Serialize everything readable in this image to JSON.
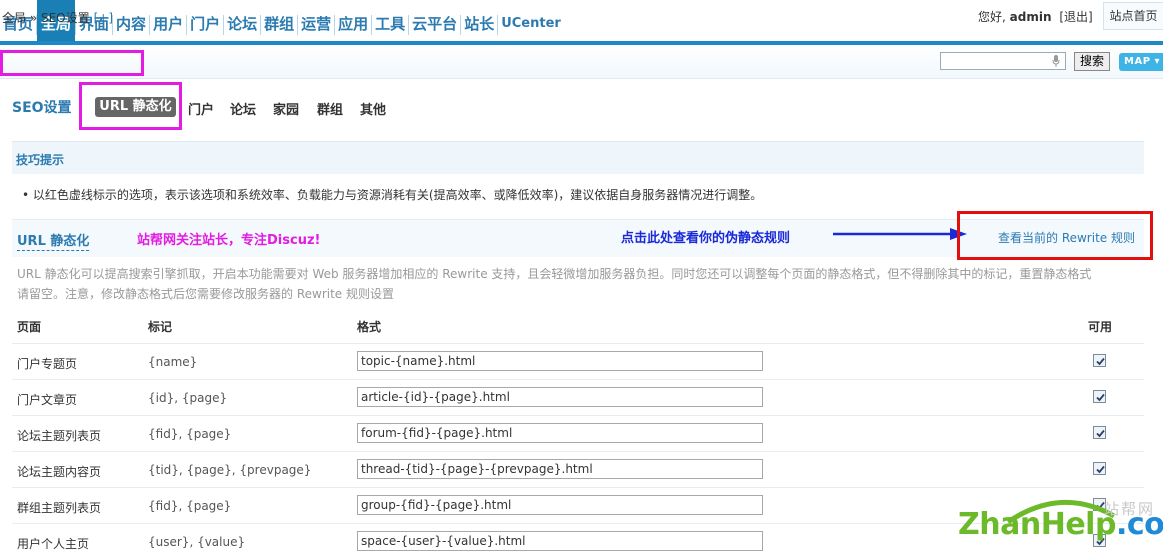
{
  "nav": {
    "tabs": [
      "首页",
      "全局",
      "界面",
      "内容",
      "用户",
      "门户",
      "论坛",
      "群组",
      "运营",
      "应用",
      "工具",
      "云平台",
      "站长",
      "UCenter"
    ],
    "active_index": 1,
    "greeting": "您好,",
    "username": "admin",
    "logout": "[退出]",
    "site_home": "站点首页"
  },
  "breadcrumb": {
    "path": "全局 » SEO设置",
    "toggle": "[+]"
  },
  "search": {
    "value": "",
    "button": "搜索",
    "map_button": "MAP"
  },
  "subtabs": {
    "title": "SEO设置",
    "active": "URL 静态化",
    "items": [
      "门户",
      "论坛",
      "家园",
      "群组",
      "其他"
    ]
  },
  "tips": {
    "title": "技巧提示",
    "text": "以红色虚线标示的选项，表示该选项和系统效率、负载能力与资源消耗有关(提高效率、或降低效率)，建议依据自身服务器情况进行调整。"
  },
  "url_section": {
    "title": "URL 静态化",
    "promo": "站帮网关注站长，专注Discuz!",
    "hint": "点击此处查看你的伪静态规则",
    "rewrite_link": "查看当前的 Rewrite 规则",
    "description": "URL 静态化可以提高搜索引擎抓取，开启本功能需要对 Web 服务器增加相应的 Rewrite 支持，且会轻微增加服务器负担。同时您还可以调整每个页面的静态格式，但不得删除其中的标记，重置静态格式请留空。注意，修改静态格式后您需要修改服务器的 Rewrite 规则设置"
  },
  "table": {
    "headers": {
      "page": "页面",
      "tag": "标记",
      "format": "格式",
      "enabled": "可用"
    },
    "rows": [
      {
        "page": "门户专题页",
        "tag": "{name}",
        "format": "topic-{name}.html",
        "enabled": true
      },
      {
        "page": "门户文章页",
        "tag": "{id}, {page}",
        "format": "article-{id}-{page}.html",
        "enabled": true
      },
      {
        "page": "论坛主题列表页",
        "tag": "{fid}, {page}",
        "format": "forum-{fid}-{page}.html",
        "enabled": true
      },
      {
        "page": "论坛主题内容页",
        "tag": "{tid}, {page}, {prevpage}",
        "format": "thread-{tid}-{page}-{prevpage}.html",
        "enabled": true
      },
      {
        "page": "群组主题列表页",
        "tag": "{fid}, {page}",
        "format": "group-{fid}-{page}.html",
        "enabled": true
      },
      {
        "page": "用户个人主页",
        "tag": "{user}, {value}",
        "format": "space-{user}-{value}.html",
        "enabled": true
      }
    ]
  },
  "watermark": {
    "cn": "站帮网",
    "part1": "ZhanHelp",
    "part2": ".com"
  },
  "colors": {
    "nav_blue": "#1a7fb5",
    "link_blue": "#2b7bb0",
    "annotation_magenta": "#e31be3",
    "annotation_red": "#e30e0e",
    "hint_blue": "#1a2ad8"
  }
}
